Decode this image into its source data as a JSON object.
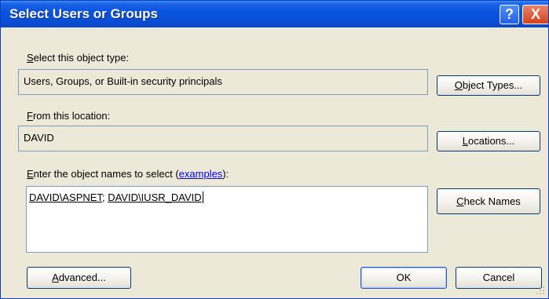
{
  "window": {
    "title": "Select Users or Groups"
  },
  "titlebar_buttons": {
    "help": "?",
    "close": "X"
  },
  "object_type": {
    "label_mn": "S",
    "label_rest": "elect this object type:",
    "value": "Users, Groups, or Built-in security principals",
    "button_mn": "O",
    "button_rest": "bject Types..."
  },
  "location": {
    "label_mn": "F",
    "label_rest": "rom this location:",
    "value": "DAVID",
    "button_mn": "L",
    "button_rest": "ocations..."
  },
  "names": {
    "label_mn": "E",
    "label_rest": "nter the object names to select (",
    "link": "examples",
    "label_end": "):",
    "name1": "DAVID\\ASPNET",
    "sep": "; ",
    "name2": "DAVID\\IUSR_DAVID",
    "check_mn": "C",
    "check_rest": "heck Names"
  },
  "footer": {
    "advanced_mn": "A",
    "advanced_rest": "dvanced...",
    "ok": "OK",
    "cancel": "Cancel"
  }
}
